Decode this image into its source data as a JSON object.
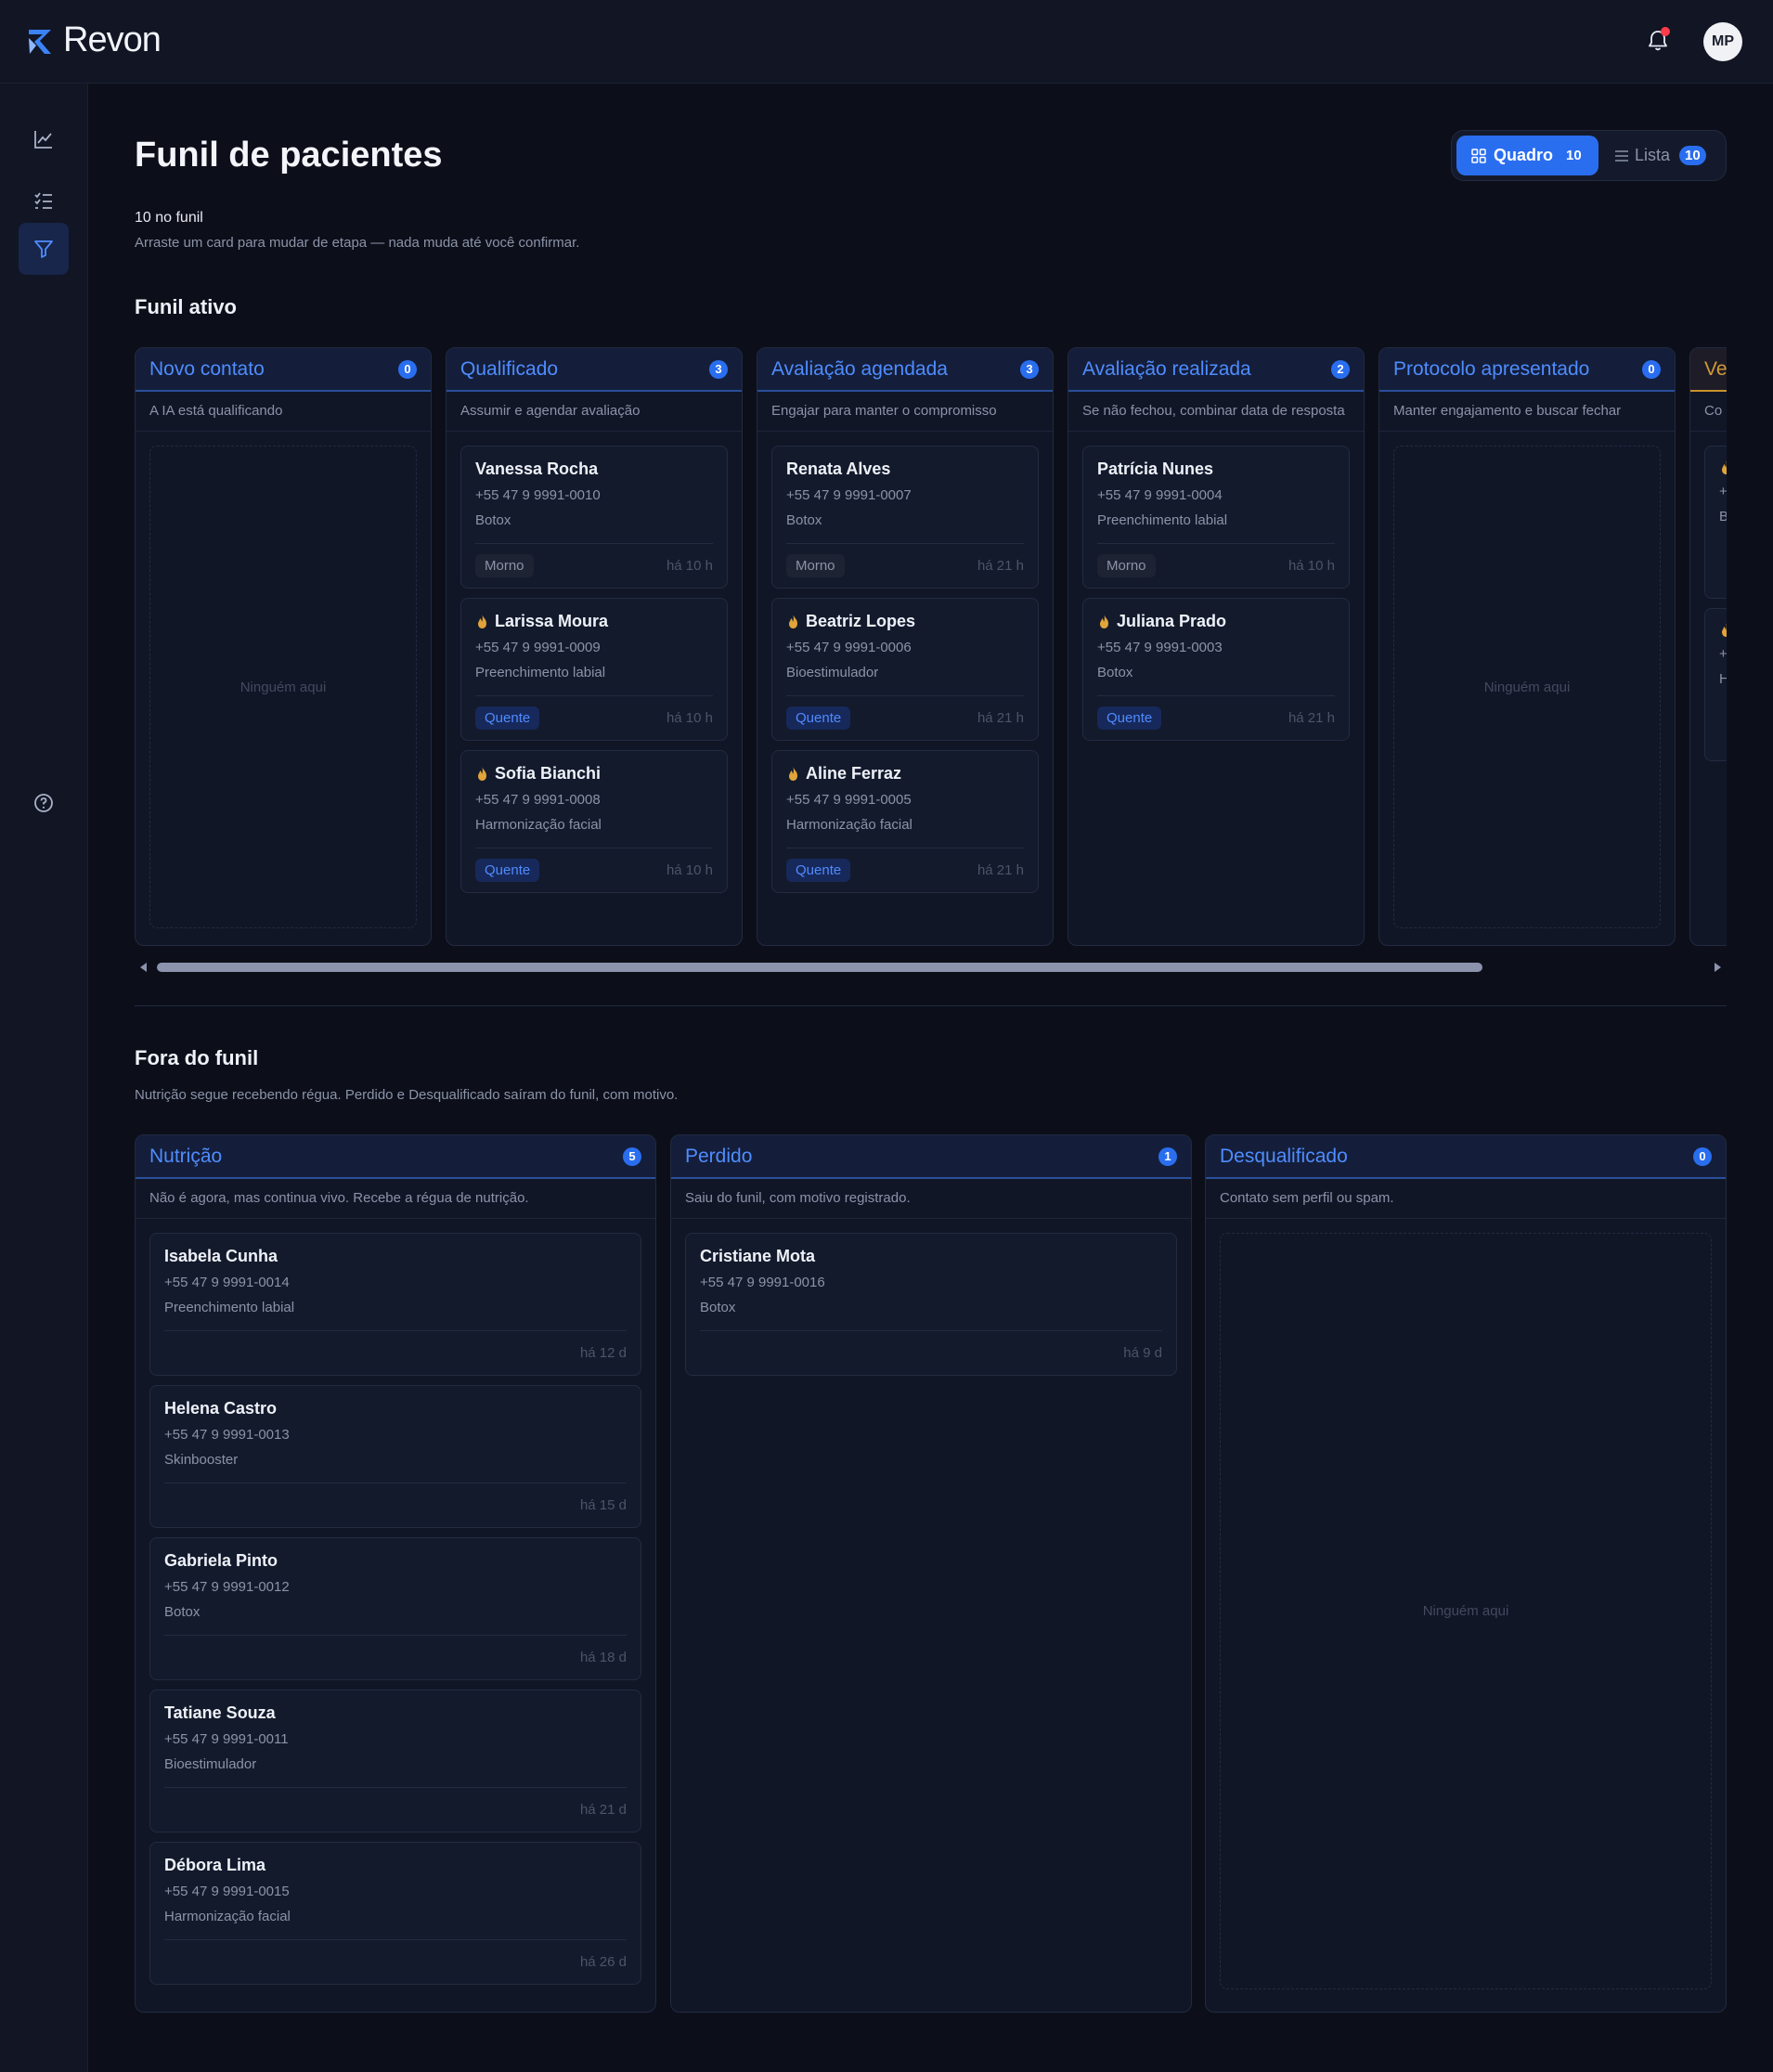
{
  "app": {
    "name": "Revon",
    "user_initials": "MP"
  },
  "sidebar": {
    "items": [
      "chart-icon",
      "checklist-icon",
      "funnel-icon",
      "help-icon"
    ]
  },
  "page": {
    "title": "Funil de pacientes",
    "count_line": "10 no funil",
    "hint": "Arraste um card para mudar de etapa — nada muda até você confirmar."
  },
  "view_toggle": {
    "board_label": "Quadro",
    "board_count": "10",
    "list_label": "Lista",
    "list_count": "10"
  },
  "active_funnel": {
    "title": "Funil ativo",
    "columns": [
      {
        "title": "Novo contato",
        "count": "0",
        "desc": "A IA está qualificando",
        "empty": "Ninguém aqui",
        "cards": []
      },
      {
        "title": "Qualificado",
        "count": "3",
        "desc": "Assumir e agendar avaliação",
        "cards": [
          {
            "name": "Vanessa Rocha",
            "phone": "+55 47 9 9991-0010",
            "procedure": "Botox",
            "tag": "Morno",
            "ago": "há 10 h",
            "hot": false
          },
          {
            "name": "Larissa Moura",
            "phone": "+55 47 9 9991-0009",
            "procedure": "Preenchimento labial",
            "tag": "Quente",
            "ago": "há 10 h",
            "hot": true
          },
          {
            "name": "Sofia Bianchi",
            "phone": "+55 47 9 9991-0008",
            "procedure": "Harmonização facial",
            "tag": "Quente",
            "ago": "há 10 h",
            "hot": true
          }
        ]
      },
      {
        "title": "Avaliação agendada",
        "count": "3",
        "desc": "Engajar para manter o compromisso",
        "cards": [
          {
            "name": "Renata Alves",
            "phone": "+55 47 9 9991-0007",
            "procedure": "Botox",
            "tag": "Morno",
            "ago": "há 21 h",
            "hot": false
          },
          {
            "name": "Beatriz Lopes",
            "phone": "+55 47 9 9991-0006",
            "procedure": "Bioestimulador",
            "tag": "Quente",
            "ago": "há 21 h",
            "hot": true
          },
          {
            "name": "Aline Ferraz",
            "phone": "+55 47 9 9991-0005",
            "procedure": "Harmonização facial",
            "tag": "Quente",
            "ago": "há 21 h",
            "hot": true
          }
        ]
      },
      {
        "title": "Avaliação realizada",
        "count": "2",
        "desc": "Se não fechou, combinar data de resposta",
        "cards": [
          {
            "name": "Patrícia Nunes",
            "phone": "+55 47 9 9991-0004",
            "procedure": "Preenchimento labial",
            "tag": "Morno",
            "ago": "há 10 h",
            "hot": false
          },
          {
            "name": "Juliana Prado",
            "phone": "+55 47 9 9991-0003",
            "procedure": "Botox",
            "tag": "Quente",
            "ago": "há 21 h",
            "hot": true
          }
        ]
      },
      {
        "title": "Protocolo apresentado",
        "count": "0",
        "desc": "Manter engajamento e buscar fechar",
        "empty": "Ninguém aqui",
        "cards": []
      },
      {
        "title": "Ve",
        "count": "",
        "desc": "Co",
        "cards": [
          {
            "name": "",
            "phone": "+",
            "procedure": "B",
            "tag": "",
            "ago": "",
            "hot": true
          },
          {
            "name": "",
            "phone": "+",
            "procedure": "H",
            "tag": "",
            "ago": "",
            "hot": true
          }
        ]
      }
    ]
  },
  "outside_funnel": {
    "title": "Fora do funil",
    "subtitle": "Nutrição segue recebendo régua. Perdido e Desqualificado saíram do funil, com motivo.",
    "columns": [
      {
        "title": "Nutrição",
        "count": "5",
        "desc": "Não é agora, mas continua vivo. Recebe a régua de nutrição.",
        "cards": [
          {
            "name": "Isabela Cunha",
            "phone": "+55 47 9 9991-0014",
            "procedure": "Preenchimento labial",
            "ago": "há 12 d"
          },
          {
            "name": "Helena Castro",
            "phone": "+55 47 9 9991-0013",
            "procedure": "Skinbooster",
            "ago": "há 15 d"
          },
          {
            "name": "Gabriela Pinto",
            "phone": "+55 47 9 9991-0012",
            "procedure": "Botox",
            "ago": "há 18 d"
          },
          {
            "name": "Tatiane Souza",
            "phone": "+55 47 9 9991-0011",
            "procedure": "Bioestimulador",
            "ago": "há 21 d"
          },
          {
            "name": "Débora Lima",
            "phone": "+55 47 9 9991-0015",
            "procedure": "Harmonização facial",
            "ago": "há 26 d"
          }
        ]
      },
      {
        "title": "Perdido",
        "count": "1",
        "desc": "Saiu do funil, com motivo registrado.",
        "cards": [
          {
            "name": "Cristiane Mota",
            "phone": "+55 47 9 9991-0016",
            "procedure": "Botox",
            "ago": "há 9 d"
          }
        ]
      },
      {
        "title": "Desqualificado",
        "count": "0",
        "desc": "Contato sem perfil ou spam.",
        "empty": "Ninguém aqui",
        "cards": []
      }
    ]
  },
  "colors": {
    "accent": "#2a6ef0",
    "accent_text": "#4f8cff",
    "hot": "#e0a43a",
    "background": "#0c0f1a"
  }
}
